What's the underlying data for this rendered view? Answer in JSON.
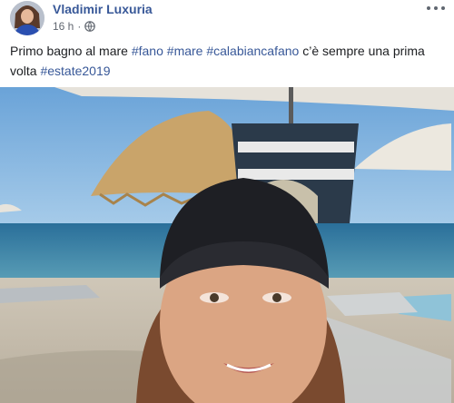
{
  "post": {
    "author": "Vladimir Luxuria",
    "timestamp": "16 h",
    "separator": "·",
    "privacy_icon": "globe-icon",
    "menu_icon": "more-options-icon",
    "text_parts": [
      {
        "type": "text",
        "value": "Primo bagno al mare "
      },
      {
        "type": "hashtag",
        "value": "#fano"
      },
      {
        "type": "text",
        "value": " "
      },
      {
        "type": "hashtag",
        "value": "#mare"
      },
      {
        "type": "text",
        "value": " "
      },
      {
        "type": "hashtag",
        "value": "#calabiancafano"
      },
      {
        "type": "text",
        "value": " c’è sempre una prima volta "
      },
      {
        "type": "hashtag",
        "value": "#estate2019"
      }
    ]
  },
  "colors": {
    "link": "#385898",
    "meta": "#616770",
    "text": "#1c1e21"
  }
}
